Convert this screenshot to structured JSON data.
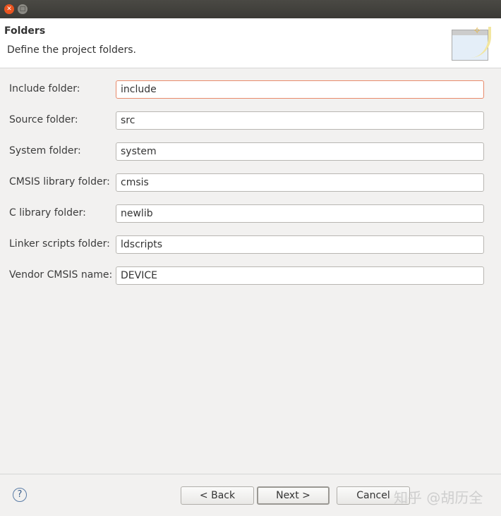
{
  "window": {
    "close_icon": "close-icon",
    "maximize_icon": "maximize-icon"
  },
  "header": {
    "title": "Folders",
    "description": "Define the project folders."
  },
  "fields": [
    {
      "label": "Include folder:",
      "value": "include"
    },
    {
      "label": "Source folder:",
      "value": "src"
    },
    {
      "label": "System folder:",
      "value": "system"
    },
    {
      "label": "CMSIS library folder:",
      "value": "cmsis"
    },
    {
      "label": "C library folder:",
      "value": "newlib"
    },
    {
      "label": "Linker scripts folder:",
      "value": "ldscripts"
    },
    {
      "label": "Vendor CMSIS name:",
      "value": "DEVICE"
    }
  ],
  "footer": {
    "help": "?",
    "back": "< Back",
    "next": "Next >",
    "cancel": "Cancel"
  },
  "watermark": "知乎 @胡历全"
}
